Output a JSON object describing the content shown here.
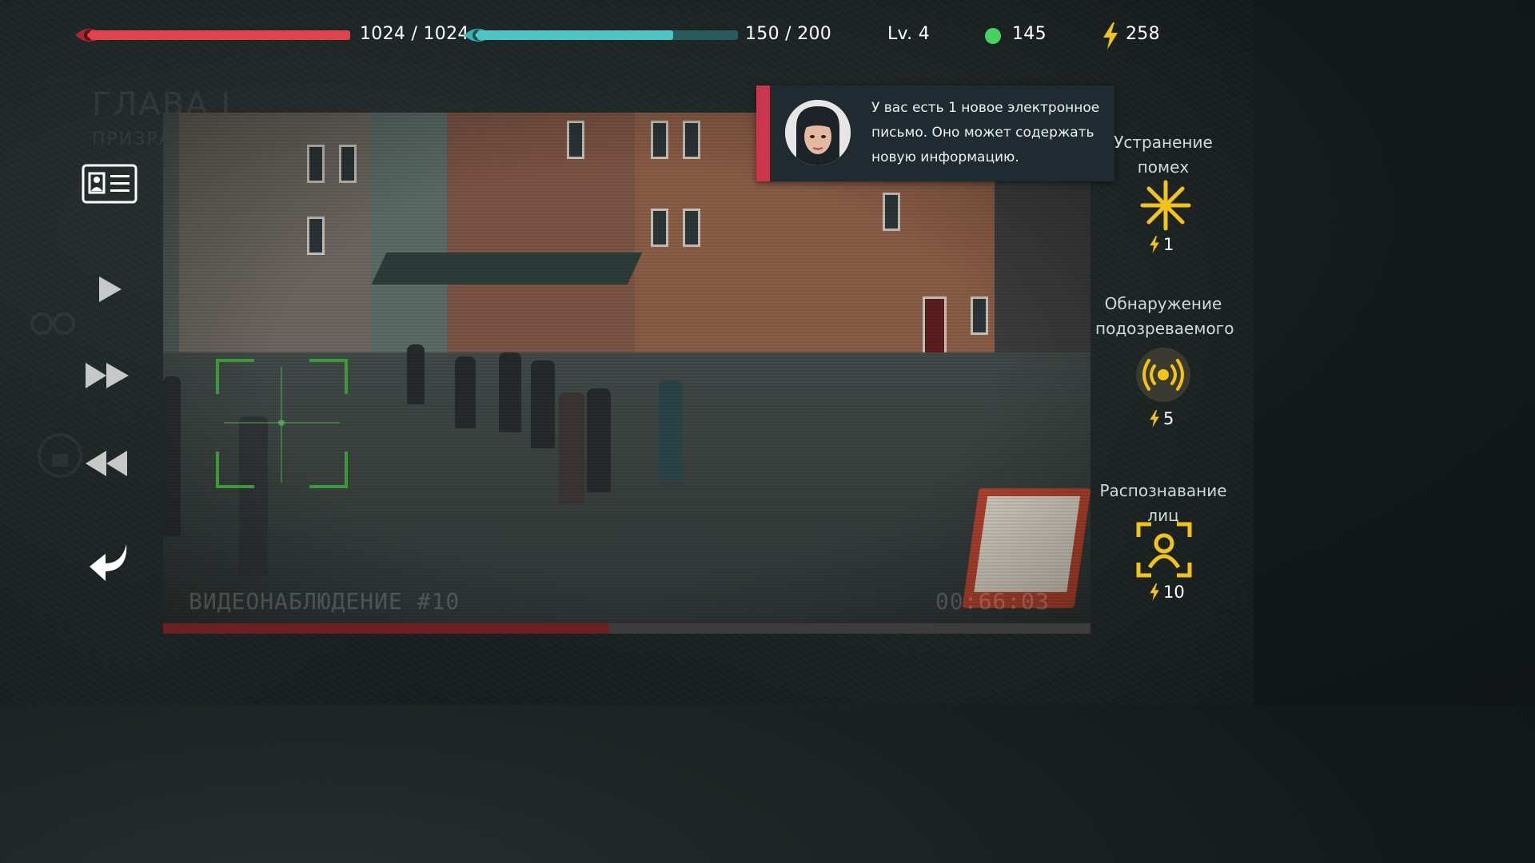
{
  "hud": {
    "hp_text": "1024 / 1024",
    "hp_fraction": 1.0,
    "mp_text": "150 / 200",
    "mp_fraction": 0.75,
    "level_text": "Lv. 4",
    "coins_text": "145",
    "energy_text": "258",
    "colors": {
      "hp": "#e1434d",
      "mp": "#4fc5c6",
      "coin": "#47d160",
      "energy": "#f2c31b"
    }
  },
  "chapter": {
    "title": "ГЛАВА I",
    "subtitle": "ПРИЗРА"
  },
  "controls": {
    "icons": [
      "id-card-icon",
      "play-icon",
      "fast-forward-icon",
      "rewind-icon",
      "back-arrow-icon"
    ]
  },
  "video": {
    "camera_label": "ВИДЕОНАБЛЮДЕНИЕ #10",
    "timecode": "00:66:03",
    "progress_fraction": 0.48
  },
  "notification": {
    "text": "У вас есть 1 новое электронное письмо. Оно может содержать новую информацию.",
    "accent": "#c8374b"
  },
  "abilities": [
    {
      "title": "Устранение помех",
      "cost": "1",
      "icon": "noise-removal-icon"
    },
    {
      "title": "Обнаружение подозреваемого",
      "cost": "5",
      "icon": "suspect-detection-icon"
    },
    {
      "title": "Распознавание лиц",
      "cost": "10",
      "icon": "face-recognition-icon"
    }
  ]
}
